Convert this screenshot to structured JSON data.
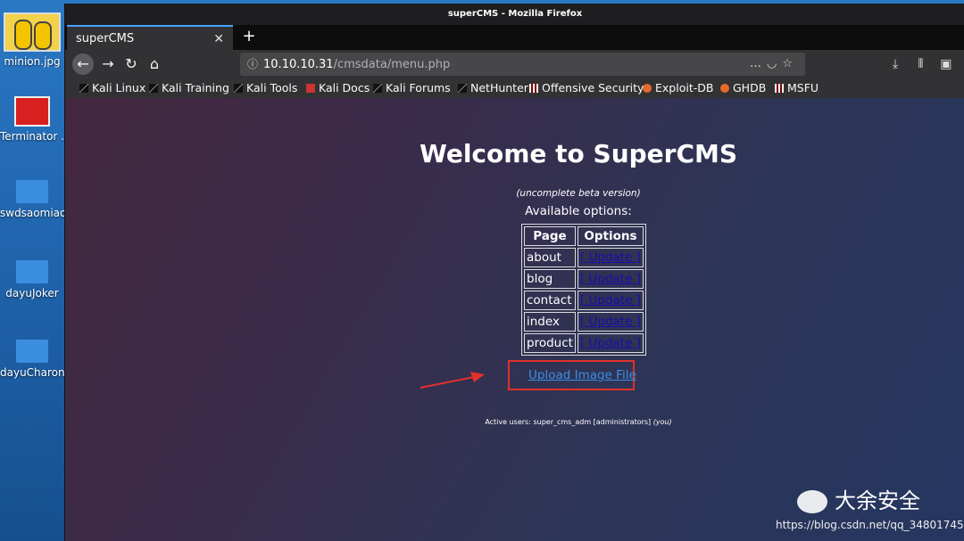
{
  "desktop": {
    "icons": [
      {
        "label": "minion.jpg"
      },
      {
        "label": "Terminator ..."
      },
      {
        "label": "swdsaomiao"
      },
      {
        "label": "dayuJoker"
      },
      {
        "label": "dayuCharon"
      }
    ]
  },
  "window": {
    "title": "superCMS - Mozilla Firefox",
    "tab_title": "superCMS",
    "url_host": "10.10.10.31",
    "url_path": "/cmsdata/menu.php",
    "bookmarks": [
      "Kali Linux",
      "Kali Training",
      "Kali Tools",
      "Kali Docs",
      "Kali Forums",
      "NetHunter",
      "Offensive Security",
      "Exploit-DB",
      "GHDB",
      "MSFU"
    ]
  },
  "page": {
    "title": "Welcome to SuperCMS",
    "subtitle": "(uncomplete beta version)",
    "available": "Available options:",
    "table": {
      "headers": [
        "Page",
        "Options"
      ],
      "rows": [
        {
          "page": "about",
          "option": "[ Update ]"
        },
        {
          "page": "blog",
          "option": "[ Update ]"
        },
        {
          "page": "contact",
          "option": "[ Update ]"
        },
        {
          "page": "index",
          "option": "[ Update ]"
        },
        {
          "page": "product",
          "option": "[ Update ]"
        }
      ]
    },
    "upload_link": "Upload Image File",
    "active_users_prefix": "Active users: super_cms_adm [administrators] ",
    "active_users_you": "(you)"
  },
  "watermark": {
    "brand": "大余安全",
    "url": "https://blog.csdn.net/qq_34801745"
  },
  "colors": {
    "annotation": "#e0312b",
    "link": "#1a0dab"
  }
}
